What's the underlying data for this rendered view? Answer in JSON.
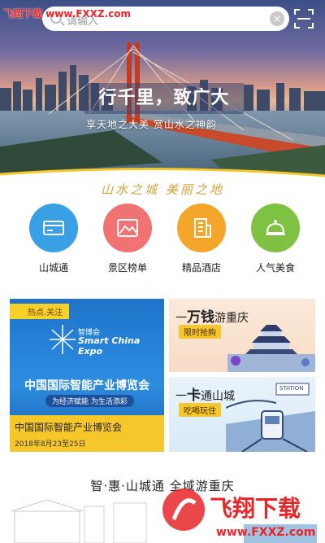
{
  "watermark_top": "飞翔下载 www.FXXZ.com",
  "search": {
    "placeholder": "请输入"
  },
  "hero": {
    "title": "行千里，致广大",
    "subtitle": "享天地之大美 赏山水之神韵"
  },
  "slogan": "山水之城 美丽之地",
  "quick_nav": [
    {
      "label": "山城通",
      "icon": "card-icon",
      "color": "#3aa0e6"
    },
    {
      "label": "景区榜单",
      "icon": "mountain-photo-icon",
      "color": "#f07272"
    },
    {
      "label": "精品酒店",
      "icon": "building-icon",
      "color": "#f4a62a"
    },
    {
      "label": "人气美食",
      "icon": "food-cloche-icon",
      "color": "#7fc241"
    }
  ],
  "card_expo": {
    "tag": "热点.关注",
    "logo_cn": "智博会",
    "logo_en_1": "Smart China",
    "logo_en_2": "Expo",
    "headline": "中国国际智能产业博览会",
    "tagline": "为经济赋能 为生活添彩",
    "title": "中国国际智能产业博览会",
    "date": "2018年8月23至25日"
  },
  "card_travel": {
    "prefix": "一",
    "highlight": "万钱",
    "rest": "游重庆",
    "badge": "限时抢购"
  },
  "card_pass": {
    "prefix": "一",
    "highlight": "卡",
    "rest": "通山城",
    "badge": "吃喝玩住",
    "sign": "STATION"
  },
  "bottom_title": "智·惠·山城通 全域游重庆",
  "watermark_br": {
    "text": "飞翔下载",
    "url": "www.FXXZ.com"
  },
  "colors": {
    "accent_yellow": "#f5c72b",
    "expo_blue": "#2c8de0",
    "watermark_red": "#e8262a"
  }
}
